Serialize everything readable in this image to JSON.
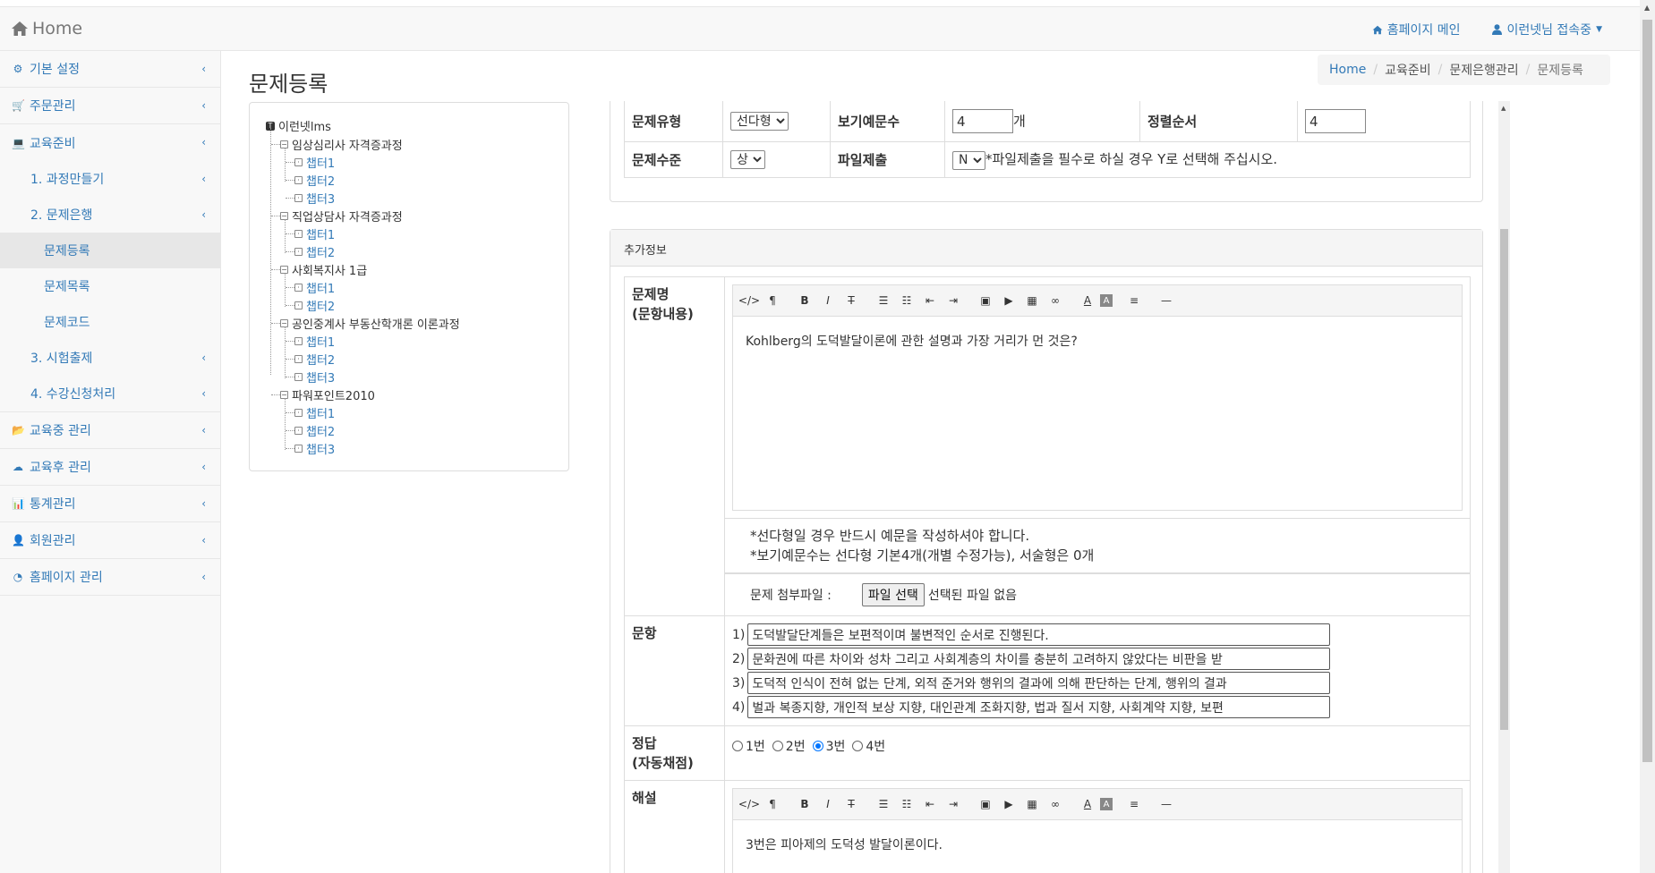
{
  "navbar": {
    "brand": "Home",
    "homepage_link": "홈페이지 메인",
    "user_menu": "이런넷님 접속중"
  },
  "sidebar": {
    "items": [
      {
        "label": "기본 설정",
        "icon": "gears-icon"
      },
      {
        "label": "주문관리",
        "icon": "cart-icon"
      },
      {
        "label": "교육준비",
        "icon": "laptop-icon"
      },
      {
        "label": "1. 과정만들기"
      },
      {
        "label": "2. 문제은행"
      },
      {
        "label": "문제등록"
      },
      {
        "label": "문제목록"
      },
      {
        "label": "문제코드"
      },
      {
        "label": "3. 시험출제"
      },
      {
        "label": "4. 수강신청처리"
      },
      {
        "label": "교육중 관리",
        "icon": "folder-open-icon"
      },
      {
        "label": "교육후 관리",
        "icon": "cloud-upload-icon"
      },
      {
        "label": "통계관리",
        "icon": "bar-chart-icon"
      },
      {
        "label": "회원관리",
        "icon": "user-icon"
      },
      {
        "label": "홈페이지 관리",
        "icon": "dashboard-icon"
      }
    ]
  },
  "page": {
    "title": "문제등록"
  },
  "breadcrumb": [
    "Home",
    "교육준비",
    "문제은행관리",
    "문제등록"
  ],
  "tree": {
    "root": "이런넷lms",
    "courses": [
      {
        "name": "임상심리사 자격증과정",
        "chapters": [
          "챕터1",
          "챕터2",
          "챕터3"
        ]
      },
      {
        "name": "직업상담사 자격증과정",
        "chapters": [
          "챕터1",
          "챕터2"
        ]
      },
      {
        "name": "사회복지사 1급",
        "chapters": [
          "챕터1",
          "챕터2"
        ]
      },
      {
        "name": "공인중계사 부동산학개론 이론과정",
        "chapters": [
          "챕터1",
          "챕터2",
          "챕터3"
        ]
      },
      {
        "name": "파워포인트2010",
        "chapters": [
          "챕터1",
          "챕터2",
          "챕터3"
        ]
      }
    ]
  },
  "form": {
    "type_label": "문제유형",
    "type_value": "선다형",
    "choices_label": "보기예문수",
    "choices_value": "4",
    "choices_unit": "개",
    "order_label": "정렬순서",
    "order_value": "4",
    "level_label": "문제수준",
    "level_value": "상",
    "file_label": "파일제출",
    "file_value": "N",
    "file_note": "*파일제출을 필수로 하실 경우 Y로 선택해 주십시오."
  },
  "extra": {
    "heading": "추가정보",
    "question_label_1": "문제명",
    "question_label_2": "(문항내용)",
    "question_text": "Kohlberg의 도덕발달이론에 관한 설명과 가장 거리가 먼 것은?",
    "note_1": "*선다형일 경우 반드시 예문을 작성하셔야 합니다.",
    "note_2": "*보기예문수는 선다형 기본4개(개별 수정가능), 서술형은 0개",
    "attach_label": "문제 첨부파일 :",
    "file_button": "파일 선택",
    "file_status": "선택된 파일 없음",
    "options_label": "문항",
    "options": [
      {
        "num": "1)",
        "text": "도덕발달단계들은 보편적이며 불변적인 순서로 진행된다."
      },
      {
        "num": "2)",
        "text": "문화권에 따른 차이와 성차 그리고 사회계층의 차이를 충분히 고려하지 않았다는 비판을 받"
      },
      {
        "num": "3)",
        "text": "도덕적 인식이 전혀 없는 단계, 외적 준거와 행위의 결과에 의해 판단하는 단계, 행위의 결과"
      },
      {
        "num": "4)",
        "text": "벌과 복종지향, 개인적 보상 지향, 대인관계 조화지향, 법과 질서 지향, 사회계약 지향, 보편"
      }
    ],
    "answer_label_1": "정답",
    "answer_label_2": "(자동채점)",
    "answers": [
      "1번",
      "2번",
      "3번",
      "4번"
    ],
    "answer_selected": "3번",
    "explain_label": "해설",
    "explain_text": "3번은 피아제의 도덕성 발달이론이다."
  }
}
